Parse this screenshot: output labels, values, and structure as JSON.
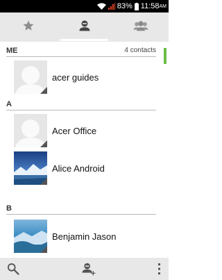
{
  "status_bar": {
    "battery": "83%",
    "time": "11:58",
    "ampm": "AM",
    "icons": [
      "wifi-icon",
      "signal-icon",
      "battery-icon"
    ]
  },
  "tabs": [
    {
      "name": "favorites",
      "icon": "star-icon",
      "active": false
    },
    {
      "name": "contacts",
      "icon": "person-icon",
      "active": true
    },
    {
      "name": "groups",
      "icon": "group-icon",
      "active": false
    }
  ],
  "me_section": {
    "label": "ME",
    "count": "4 contacts"
  },
  "sections": [
    {
      "letter": "A"
    },
    {
      "letter": "B"
    }
  ],
  "contacts": [
    {
      "name": "acer guides",
      "avatar": "default-avatar-icon"
    },
    {
      "name": "Acer Office",
      "avatar": "default-avatar-icon"
    },
    {
      "name": "Alice Android",
      "avatar": "photo-avatar"
    },
    {
      "name": "Benjamin Jason",
      "avatar": "photo-avatar"
    }
  ],
  "bottom_bar": {
    "icons": [
      "search-icon",
      "add-contact-icon",
      "overflow-menu-icon"
    ]
  },
  "colors": {
    "accent": "#6cbd45",
    "tab_bar": "#e8e8e8",
    "divider": "#b9b9b9"
  }
}
